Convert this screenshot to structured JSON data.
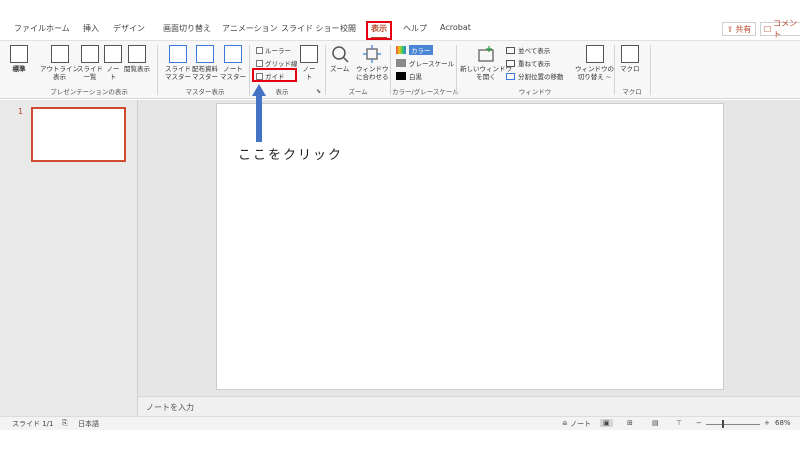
{
  "tabs": [
    "ファイル",
    "ホーム",
    "挿入",
    "デザイン",
    "画面切り替え",
    "アニメーション",
    "スライド ショー",
    "校閲",
    "表示",
    "ヘルプ",
    "Acrobat"
  ],
  "active_tab": "表示",
  "header": {
    "share_label": "共有",
    "comment_label": "コメント"
  },
  "ribbon": {
    "presentation_views": {
      "label": "プレゼンテーションの表示",
      "buttons": [
        "標準",
        "アウトライン\n表示",
        "スライド\n一覧",
        "ノー\nト",
        "閲覧表示"
      ]
    },
    "master_views": {
      "label": "マスター表示",
      "buttons": [
        "スライド\nマスター",
        "配布資料\nマスター",
        "ノート\nマスター"
      ]
    },
    "show": {
      "label": "表示",
      "checkboxes": [
        "ルーラー",
        "グリッド線",
        "ガイド"
      ],
      "notes_button": "ノー\nト"
    },
    "zoom": {
      "label": "ズーム",
      "buttons": [
        "ズーム",
        "ウィンドウ\nに合わせる"
      ]
    },
    "color": {
      "label": "カラー/グレースケール",
      "options": [
        "カラー",
        "グレースケール",
        "白黒"
      ],
      "colors": {
        "color": "#4a86d4",
        "grayscale": "#8a8a8a",
        "bw": "#000000"
      }
    },
    "window": {
      "label": "ウィンドウ",
      "new_window": "新しいウィンドウ\nを開く",
      "options": [
        "並べて表示",
        "重ねて表示",
        "分割位置の移動"
      ],
      "switch": "ウィンドウの\n切り替え ~"
    },
    "macro": {
      "label": "マクロ",
      "button": "マクロ"
    }
  },
  "slide_panel": {
    "slide_number": "1"
  },
  "notes": {
    "placeholder": "ノートを入力"
  },
  "status": {
    "slide_info": "スライド 1/1",
    "language": "日本語",
    "notes_label": "ノート",
    "zoom_level": "68%"
  },
  "annotation": {
    "text": "ここをクリック",
    "arrow_color": "#4472c4",
    "highlight_color": "#e60012"
  },
  "accent": "#b7472a"
}
